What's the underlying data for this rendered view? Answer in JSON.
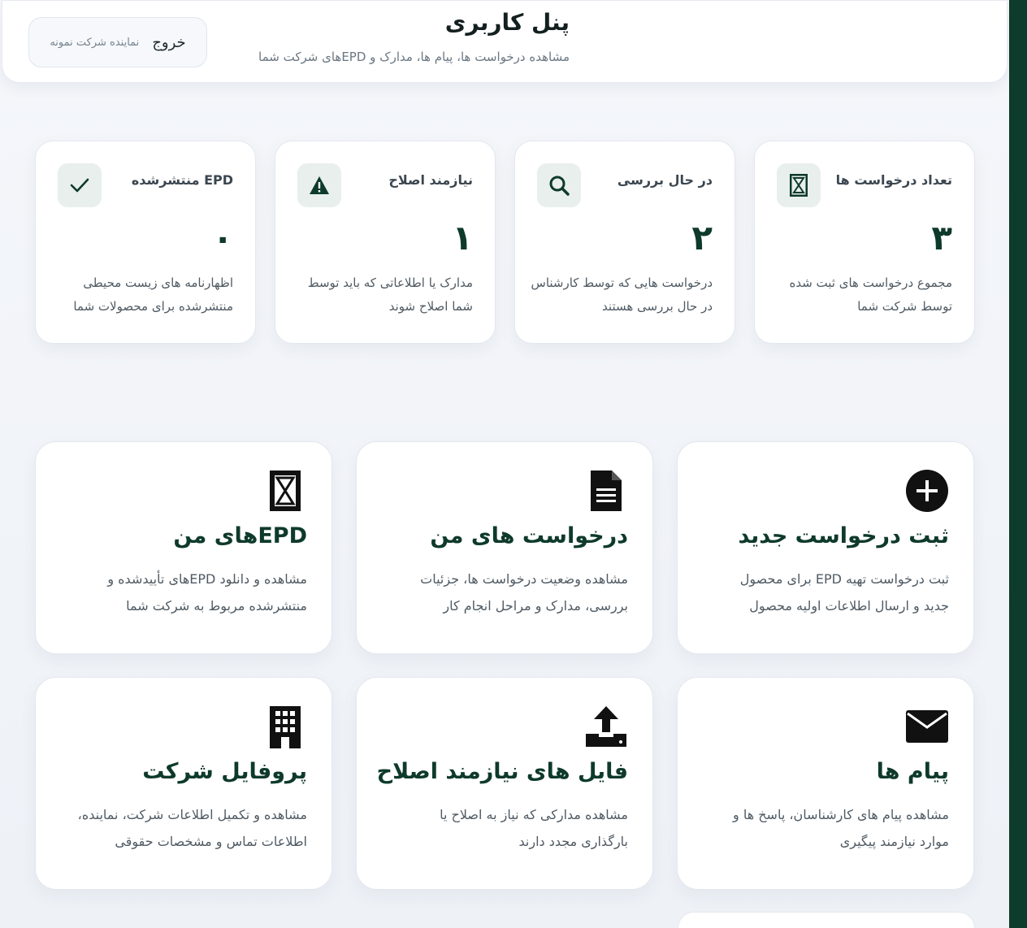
{
  "header": {
    "title": "پنل کاربری",
    "subtitle": "مشاهده درخواست ها، پیام ها، مدارک و EPDهای شرکت شما",
    "logout_label": "خروج",
    "user_name": "نماینده شرکت نمونه"
  },
  "stats": [
    {
      "label": "تعداد درخواست ها",
      "value": "۳",
      "desc": "مجموع درخواست های ثبت شده توسط شرکت شما",
      "icon": "hourglass-icon"
    },
    {
      "label": "در حال بررسی",
      "value": "۲",
      "desc": "درخواست هایی که توسط کارشناس در حال بررسی هستند",
      "icon": "search-icon"
    },
    {
      "label": "نیازمند اصلاح",
      "value": "۱",
      "desc": "مدارک یا اطلاعاتی که باید توسط شما اصلاح شوند",
      "icon": "warning-icon"
    },
    {
      "label": "EPD منتشرشده",
      "value": "۰",
      "desc": "اظهارنامه های زیست محیطی منتشرشده برای محصولات شما",
      "icon": "check-icon"
    }
  ],
  "features": [
    {
      "title": "ثبت درخواست جدید",
      "desc": "ثبت درخواست تهیه EPD برای محصول جدید و ارسال اطلاعات اولیه محصول",
      "icon": "plus-circle-icon"
    },
    {
      "title": "درخواست های من",
      "desc": "مشاهده وضعیت درخواست ها، جزئیات بررسی، مدارک و مراحل انجام کار",
      "icon": "document-icon"
    },
    {
      "title": "EPDهای من",
      "desc": "مشاهده و دانلود EPDهای تأییدشده و منتشرشده مربوط به شرکت شما",
      "icon": "hourglass-icon"
    },
    {
      "title": "پیام ها",
      "desc": "مشاهده پیام های کارشناسان، پاسخ ها و موارد نیازمند پیگیری",
      "icon": "envelope-icon"
    },
    {
      "title": "فایل های نیازمند اصلاح",
      "desc": "مشاهده مدارکی که نیاز به اصلاح یا بارگذاری مجدد دارند",
      "icon": "upload-icon"
    },
    {
      "title": "پروفایل شرکت",
      "desc": "مشاهده و تکمیل اطلاعات شرکت، نماینده، اطلاعات تماس و مشخصات حقوقی",
      "icon": "building-icon"
    }
  ],
  "colors": {
    "accent_dark_green": "#0e3a2b",
    "side_strip": "#0d3b2c",
    "icon_bg": "#e8efec",
    "page_bg": "#eef2f7"
  }
}
